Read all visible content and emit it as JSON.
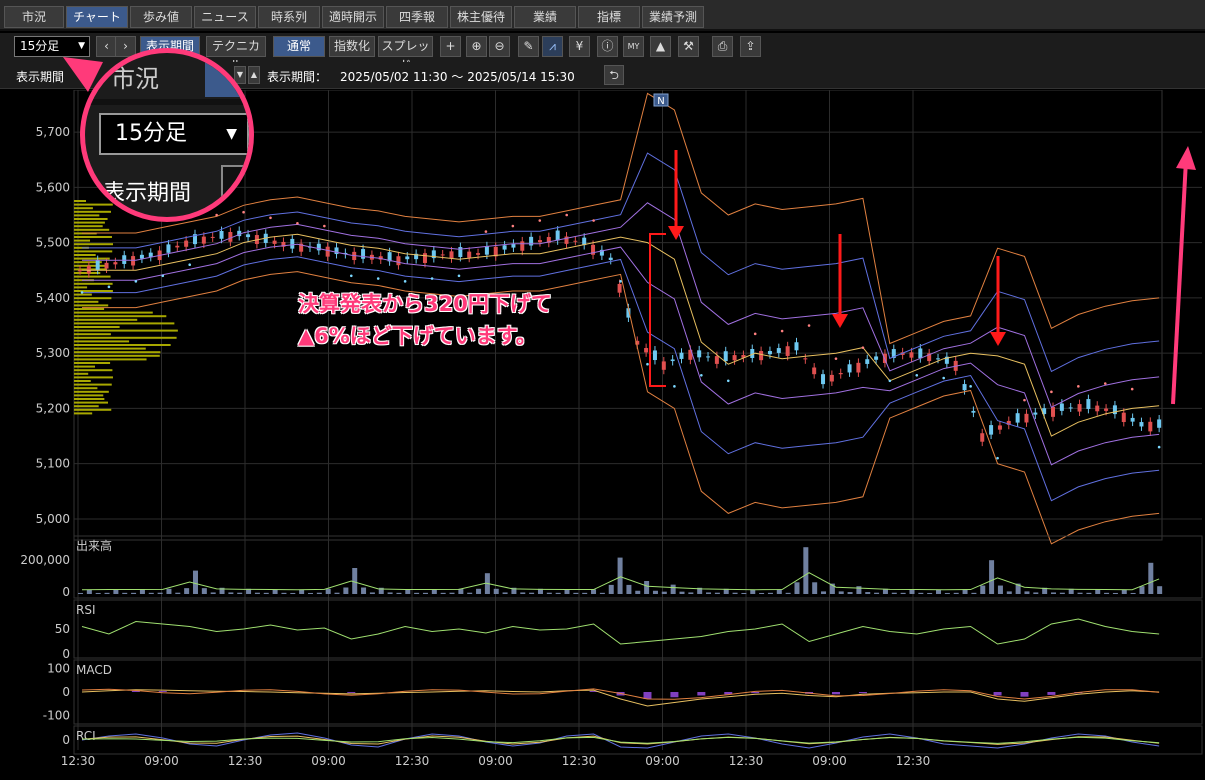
{
  "tabs": [
    "市況",
    "チャート",
    "歩み値",
    "ニュース",
    "時系列",
    "適時開示",
    "四季報",
    "株主優待",
    "業績",
    "指標",
    "業績予測"
  ],
  "active_tab": "チャート",
  "toolbar": {
    "interval": "15分足",
    "prev_icon": "chevron-left-icon",
    "next_icon": "chevron-right-icon",
    "period_button": "表示期間",
    "technical_button": "テクニカル",
    "normal_button": "通常",
    "index_button": "指数化",
    "spread_button": "スプレッド",
    "icons": [
      "crosshair-icon",
      "zoom-in-icon",
      "zoom-out-icon",
      "pencil-icon",
      "signal-icon",
      "yen-icon",
      "info-icon",
      "my-icon",
      "area-chart-icon",
      "wrench-icon",
      "print-icon",
      "export-icon"
    ]
  },
  "period_row": {
    "label": "表示期間",
    "range_label": "表示期間：",
    "range_value": "2025/05/02 11:30 ～ 2025/05/14 15:30"
  },
  "magnifier": {
    "tab": "市況",
    "select": "15分足",
    "period": "表示期間"
  },
  "news_badge": "N",
  "annotation": {
    "line1": "決算発表から320円下げて",
    "line2": "▲6%ほど下げています。"
  },
  "colors": {
    "annotation": "#ff3a7a",
    "candle_up": "#e05050",
    "candle_down": "#6ec8f0",
    "volume_profile": "#a8a800",
    "arrow": "#ff1a1a",
    "volume_bar": "#7080a0"
  },
  "chart_data": [
    {
      "type": "candlestick",
      "y_ticks": [
        "5,700",
        "5,600",
        "5,500",
        "5,400",
        "5,300",
        "5,200",
        "5,100",
        "5,000"
      ],
      "ylim": [
        4980,
        5740
      ],
      "x_ticks": [
        "12:30",
        "09:00",
        "12:30",
        "09:00",
        "12:30",
        "09:00",
        "12:30",
        "09:00",
        "12:30",
        "09:00",
        "12:30"
      ],
      "close_path": [
        5450,
        5460,
        5470,
        5480,
        5500,
        5510,
        5515,
        5505,
        5495,
        5490,
        5480,
        5475,
        5470,
        5475,
        5480,
        5480,
        5490,
        5500,
        5510,
        5500,
        5470,
        5320,
        5280,
        5300,
        5290,
        5295,
        5300,
        5310,
        5250,
        5270,
        5290,
        5300,
        5295,
        5280,
        5150,
        5175,
        5190,
        5200,
        5205,
        5195,
        5170
      ]
    },
    {
      "type": "bar",
      "label": "出来高",
      "y_ticks": [
        "200,000",
        "0"
      ],
      "values": [
        8,
        9,
        9,
        10,
        45,
        12,
        10,
        9,
        8,
        10,
        50,
        12,
        9,
        9,
        10,
        40,
        12,
        10,
        9,
        9,
        70,
        25,
        18,
        12,
        10,
        8,
        9,
        90,
        20,
        15,
        10,
        9,
        8,
        9,
        65,
        20,
        12,
        10,
        9,
        8,
        60
      ]
    },
    {
      "type": "line",
      "label": "RSI",
      "y_ticks": [
        "50",
        "0"
      ],
      "values": [
        55,
        40,
        65,
        60,
        55,
        45,
        50,
        58,
        48,
        52,
        30,
        40,
        55,
        45,
        50,
        42,
        55,
        48,
        50,
        60,
        20,
        25,
        30,
        35,
        45,
        50,
        60,
        25,
        40,
        55,
        45,
        40,
        50,
        55,
        20,
        30,
        60,
        70,
        55,
        45,
        40
      ]
    },
    {
      "type": "line",
      "label": "MACD",
      "y_ticks": [
        "100",
        "0",
        "-100"
      ],
      "values": [
        0,
        5,
        10,
        8,
        5,
        3,
        2,
        0,
        -3,
        -5,
        -8,
        -5,
        -2,
        0,
        3,
        5,
        2,
        0,
        5,
        8,
        -30,
        -60,
        -45,
        -30,
        -20,
        -10,
        -5,
        -15,
        -20,
        -10,
        -5,
        -3,
        0,
        0,
        -30,
        -40,
        -25,
        -10,
        0,
        5,
        0
      ]
    },
    {
      "type": "line",
      "label": "RCI",
      "y_ticks": [
        "0"
      ],
      "values": [
        0,
        40,
        60,
        20,
        -40,
        -60,
        0,
        50,
        70,
        20,
        -50,
        -70,
        10,
        60,
        40,
        -20,
        -60,
        -30,
        40,
        60,
        -70,
        -80,
        -20,
        40,
        60,
        20,
        -40,
        -80,
        -30,
        30,
        60,
        20,
        -40,
        -60,
        -80,
        -40,
        20,
        60,
        40,
        -20,
        -60
      ]
    }
  ]
}
